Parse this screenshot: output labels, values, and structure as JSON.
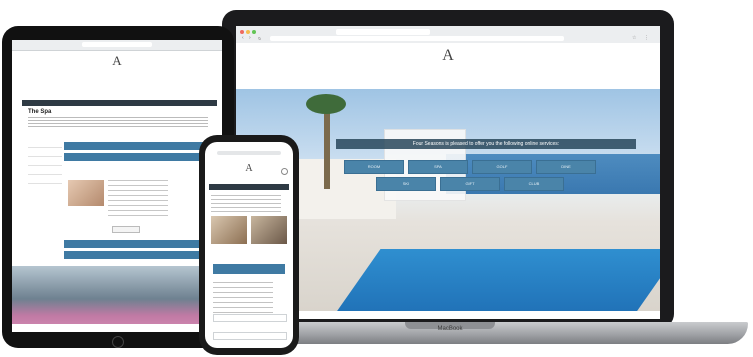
{
  "laptop": {
    "label": "MacBook",
    "browser": {
      "tab_title": "",
      "url": ""
    },
    "site": {
      "logo_letter": "A",
      "logo_text": "",
      "language": "",
      "signin": ""
    },
    "hero": {
      "banner": "Four Seasons is pleased to offer you the following online services:",
      "services_row1": [
        "ROOM",
        "SPA",
        "GOLF",
        "DINE"
      ],
      "services_row2": [
        "SKI",
        "GIFT",
        "CLUB"
      ]
    }
  },
  "ipad": {
    "logo_letter": "A",
    "page_title": "The Spa",
    "side_items": [
      "",
      "",
      "",
      "",
      ""
    ]
  },
  "iphone": {
    "logo_letter": "A"
  },
  "colors": {
    "accent": "#4a84a9",
    "nav_dark": "#2e3a44"
  }
}
